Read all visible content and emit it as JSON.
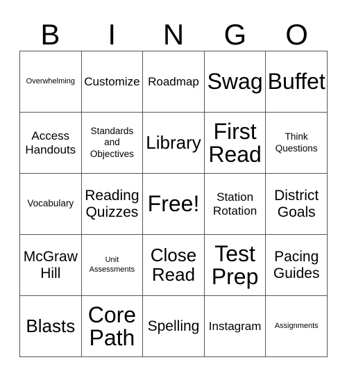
{
  "card": {
    "header_letters": [
      "B",
      "I",
      "N",
      "G",
      "O"
    ],
    "rows": [
      [
        {
          "label": "Overwhelming",
          "size": "fs-xs"
        },
        {
          "label": "Customize",
          "size": "fs-md"
        },
        {
          "label": "Roadmap",
          "size": "fs-md"
        },
        {
          "label": "Swag",
          "size": "fs-xxl"
        },
        {
          "label": "Buffet",
          "size": "fs-xxl"
        }
      ],
      [
        {
          "label": "Access Handouts",
          "size": "fs-md"
        },
        {
          "label": "Standards and Objectives",
          "size": "fs-sm"
        },
        {
          "label": "Library",
          "size": "fs-xl"
        },
        {
          "label": "First Read",
          "size": "fs-xxl"
        },
        {
          "label": "Think Questions",
          "size": "fs-sm"
        }
      ],
      [
        {
          "label": "Vocabulary",
          "size": "fs-sm"
        },
        {
          "label": "Reading Quizzes",
          "size": "fs-lg"
        },
        {
          "label": "Free!",
          "size": "fs-xxl"
        },
        {
          "label": "Station Rotation",
          "size": "fs-md"
        },
        {
          "label": "District Goals",
          "size": "fs-lg"
        }
      ],
      [
        {
          "label": "McGraw Hill",
          "size": "fs-lg"
        },
        {
          "label": "Unit Assessments",
          "size": "fs-xs"
        },
        {
          "label": "Close Read",
          "size": "fs-xl"
        },
        {
          "label": "Test Prep",
          "size": "fs-xxl"
        },
        {
          "label": "Pacing Guides",
          "size": "fs-lg"
        }
      ],
      [
        {
          "label": "Blasts",
          "size": "fs-xl"
        },
        {
          "label": "Core Path",
          "size": "fs-xxl"
        },
        {
          "label": "Spelling",
          "size": "fs-lg"
        },
        {
          "label": "Instagram",
          "size": "fs-md"
        },
        {
          "label": "Assignments",
          "size": "fs-xs"
        }
      ]
    ],
    "free_space": {
      "row": 2,
      "column": 2,
      "label": "Free!"
    },
    "colors": {
      "background": "#ffffff",
      "text": "#000000",
      "grid_line": "#555555"
    }
  }
}
